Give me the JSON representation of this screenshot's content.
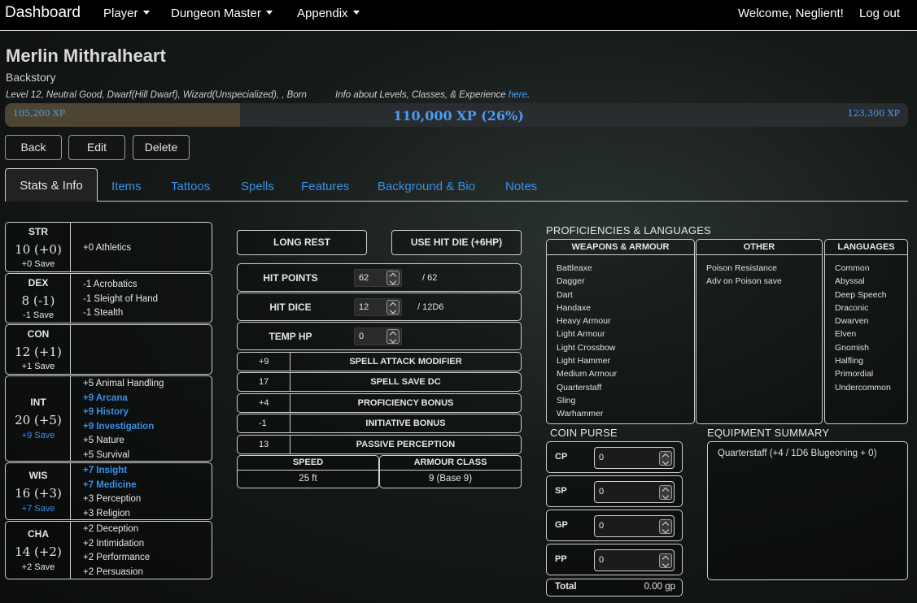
{
  "nav": {
    "brand": "Dashboard",
    "menus": [
      "Player",
      "Dungeon Master",
      "Appendix"
    ],
    "welcome": "Welcome, Neglient!",
    "logout": "Log out"
  },
  "character": {
    "name": "Merlin Mithralheart",
    "backstory_link": "Backstory",
    "description": "Level 12, Neutral Good, Dwarf(Hill Dwarf), Wizard(Unspecialized), , Born",
    "info_text": "Info about Levels, Classes, & Experience ",
    "info_link": "here",
    "info_suffix": "."
  },
  "xp": {
    "min_label": "105,200 XP",
    "current_label": "110,000 XP (26%)",
    "max_label": "123,300 XP",
    "progress_fraction": 0.26
  },
  "actions": {
    "back": "Back",
    "edit": "Edit",
    "delete": "Delete"
  },
  "tabs": [
    "Stats & Info",
    "Items",
    "Tattoos",
    "Spells",
    "Features",
    "Background & Bio",
    "Notes"
  ],
  "stats": [
    {
      "abbr": "STR",
      "value": "10 (+0)",
      "save": "+0 Save",
      "save_prof": false,
      "skills": [
        {
          "t": "+0 Athletics",
          "p": false
        }
      ]
    },
    {
      "abbr": "DEX",
      "value": "8 (-1)",
      "save": "-1 Save",
      "save_prof": false,
      "skills": [
        {
          "t": "-1 Acrobatics",
          "p": false
        },
        {
          "t": "-1 Sleight of Hand",
          "p": false
        },
        {
          "t": "-1 Stealth",
          "p": false
        }
      ]
    },
    {
      "abbr": "CON",
      "value": "12 (+1)",
      "save": "+1 Save",
      "save_prof": false,
      "skills": []
    },
    {
      "abbr": "INT",
      "value": "20 (+5)",
      "save": "+9 Save",
      "save_prof": true,
      "skills": [
        {
          "t": "+5 Animal Handling",
          "p": false
        },
        {
          "t": "+9 Arcana",
          "p": true
        },
        {
          "t": "+9 History",
          "p": true
        },
        {
          "t": "+9 Investigation",
          "p": true
        },
        {
          "t": "+5 Nature",
          "p": false
        },
        {
          "t": "+5 Survival",
          "p": false
        }
      ]
    },
    {
      "abbr": "WIS",
      "value": "16 (+3)",
      "save": "+7 Save",
      "save_prof": true,
      "skills": [
        {
          "t": "+7 Insight",
          "p": true
        },
        {
          "t": "+7 Medicine",
          "p": true
        },
        {
          "t": "+3 Perception",
          "p": false
        },
        {
          "t": "+3 Religion",
          "p": false
        }
      ]
    },
    {
      "abbr": "CHA",
      "value": "14 (+2)",
      "save": "+2 Save",
      "save_prof": false,
      "skills": [
        {
          "t": "+2 Deception",
          "p": false
        },
        {
          "t": "+2 Intimidation",
          "p": false
        },
        {
          "t": "+2 Performance",
          "p": false
        },
        {
          "t": "+2 Persuasion",
          "p": false
        }
      ]
    }
  ],
  "combat": {
    "long_rest": "LONG REST",
    "hit_die_button": "USE HIT DIE (+6HP)",
    "hit_points_label": "HIT POINTS",
    "hit_points_value": "62",
    "hit_points_max": "/ 62",
    "hit_dice_label": "HIT DICE",
    "hit_dice_value": "12",
    "hit_dice_max": "/ 12D6",
    "temp_hp_label": "TEMP HP",
    "temp_hp_value": "0",
    "modifiers": [
      {
        "value": "+9",
        "label": "SPELL ATTACK MODIFIER"
      },
      {
        "value": "17",
        "label": "SPELL SAVE DC"
      },
      {
        "value": "+4",
        "label": "PROFICIENCY BONUS"
      },
      {
        "value": "-1",
        "label": "INITIATIVE BONUS"
      },
      {
        "value": "13",
        "label": "PASSIVE PERCEPTION"
      }
    ],
    "speed_label": "SPEED",
    "speed_value": "25 ft",
    "armour_label": "ARMOUR CLASS",
    "armour_value": "9 (Base 9)"
  },
  "proficiencies": {
    "title": "PROFICIENCIES & LANGUAGES",
    "weapons_title": "WEAPONS & ARMOUR",
    "weapons": [
      "Battleaxe",
      "Dagger",
      "Dart",
      "Handaxe",
      "Heavy Armour",
      "Light Armour",
      "Light Crossbow",
      "Light Hammer",
      "Medium Armour",
      "Quarterstaff",
      "Sling",
      "Warhammer"
    ],
    "other_title": "OTHER",
    "other": [
      "Poison Resistance",
      "Adv on Poison save"
    ],
    "languages_title": "LANGUAGES",
    "languages": [
      "Common",
      "Abyssal",
      "Deep Speech",
      "Draconic",
      "Dwarven",
      "Elven",
      "Gnomish",
      "Halfling",
      "Primordial",
      "Undercommon"
    ]
  },
  "coins": {
    "title": "COIN PURSE",
    "rows": [
      {
        "label": "CP",
        "value": "0"
      },
      {
        "label": "SP",
        "value": "0"
      },
      {
        "label": "GP",
        "value": "0"
      },
      {
        "label": "PP",
        "value": "0"
      }
    ],
    "total_label": "Total",
    "total_value": "0.00 gp"
  },
  "equipment": {
    "title": "EQUIPMENT SUMMARY",
    "items": [
      "Quarterstaff (+4 / 1D6 Blugeoning + 0)"
    ]
  }
}
